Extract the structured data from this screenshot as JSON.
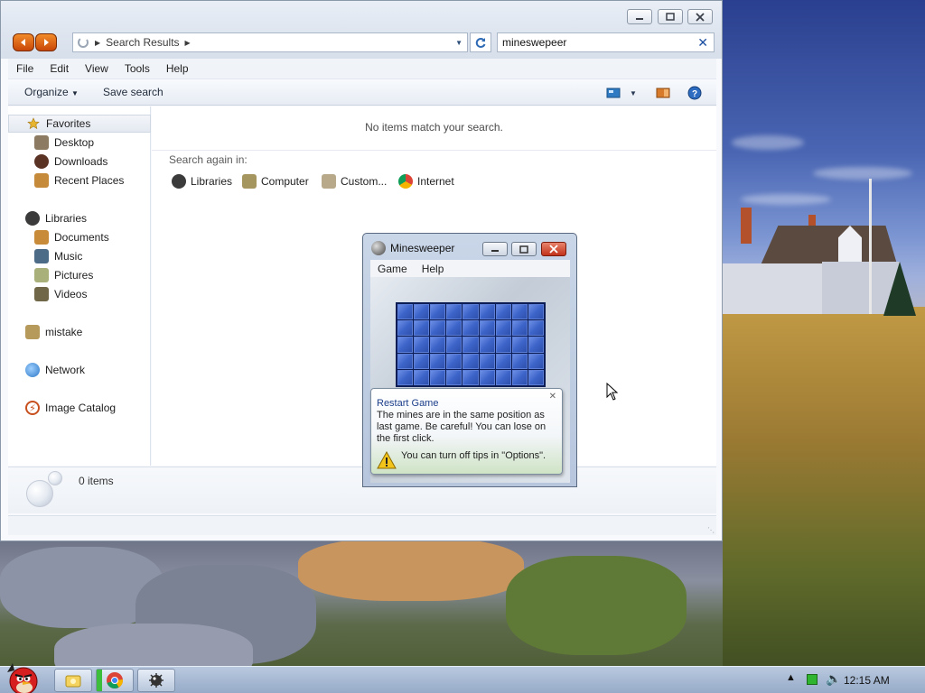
{
  "explorer": {
    "address": {
      "crumb": "Search Results",
      "search_value": "mineswepeer"
    },
    "menu": [
      "File",
      "Edit",
      "View",
      "Tools",
      "Help"
    ],
    "toolbar": {
      "organize": "Organize",
      "save_search": "Save search"
    },
    "nav": {
      "favorites": "Favorites",
      "desktop": "Desktop",
      "downloads": "Downloads",
      "recent": "Recent Places",
      "libraries": "Libraries",
      "documents": "Documents",
      "music": "Music",
      "pictures": "Pictures",
      "videos": "Videos",
      "mistake": "mistake",
      "network": "Network",
      "image_catalog": "Image Catalog"
    },
    "content": {
      "empty_message": "No items match your search.",
      "search_again": "Search again in:",
      "locations": [
        "Libraries",
        "Computer",
        "Custom...",
        "Internet"
      ]
    },
    "details": {
      "count": "0 items"
    }
  },
  "minesweeper": {
    "title": "Minesweeper",
    "menu": [
      "Game",
      "Help"
    ],
    "grid": {
      "columns": 9,
      "rows": 5
    },
    "tip": {
      "title": "Restart Game",
      "body": "The mines are in the same position as last game. Be careful! You can lose on the first click.",
      "footer": "You can turn off tips in \"Options\"."
    }
  },
  "taskbar": {
    "clock": "12:15 AM"
  },
  "colors": {
    "accent": "#1b3e8a",
    "orange_nav": "#f28b2a",
    "close_red": "#c2321a",
    "mine_tile": "#3d64c9"
  }
}
